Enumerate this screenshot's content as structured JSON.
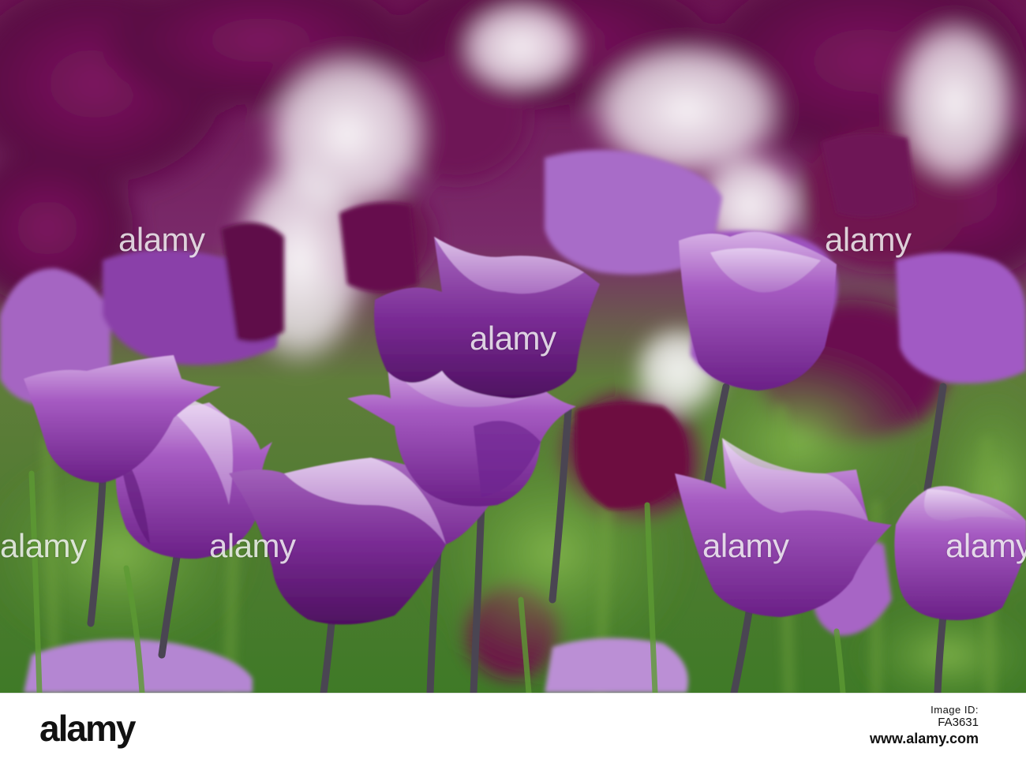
{
  "watermark": {
    "text": "alamy"
  },
  "footer": {
    "logo_text": "alamy",
    "image_id_label": "Image ID:",
    "image_id": "FA3631",
    "url": "www.alamy.com"
  },
  "colors": {
    "accent_purple": "#8e3fa6",
    "deep_plum": "#5e0f45",
    "lilac": "#c69ad8",
    "stem_green": "#4f8a2c"
  }
}
